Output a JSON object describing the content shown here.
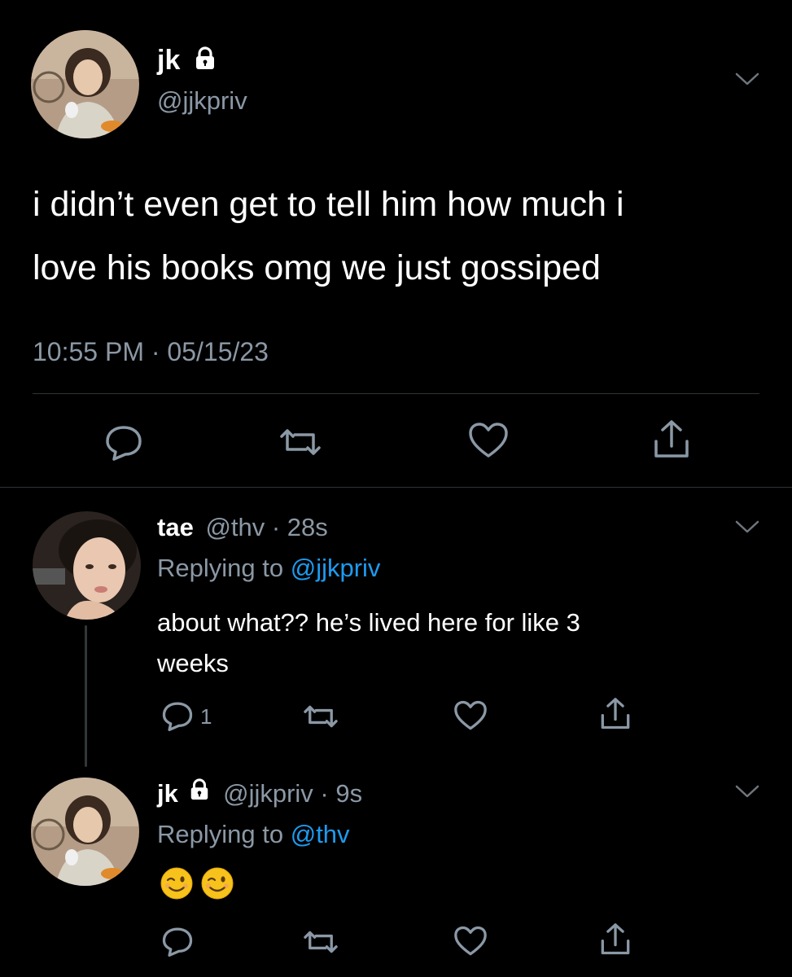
{
  "main_tweet": {
    "display_name": "jk",
    "handle": "@jjkpriv",
    "text_line1": "i didn’t even get to tell him how much i",
    "text_line2": "love his books omg we just gossiped",
    "timestamp": "10:55 PM · 05/15/23"
  },
  "reply1": {
    "display_name": "tae",
    "handle_time": "@thv · 28s",
    "replying_prefix": "Replying to ",
    "replying_handle": "@jjkpriv",
    "text_line1": "about what?? he’s lived here for like 3",
    "text_line2": "weeks",
    "reply_count": "1"
  },
  "reply2": {
    "display_name": "jk",
    "handle_time": "@jjkpriv · 9s",
    "replying_prefix": "Replying to ",
    "replying_handle": "@thv",
    "emojis": [
      "winking-face-emoji",
      "winking-face-emoji"
    ]
  },
  "colors": {
    "background": "#000000",
    "text": "#ffffff",
    "muted": "#8b98a5",
    "link": "#1d9bf0",
    "divider": "#2f3336"
  }
}
